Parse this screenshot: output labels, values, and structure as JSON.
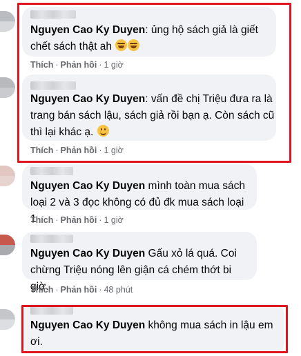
{
  "colors": {
    "bubble": "#f0f2f5",
    "text": "#050505",
    "meta": "#65676b",
    "highlight": "#e0141e"
  },
  "comments": [
    {
      "author": "Nguyen Cao Ky Duyen",
      "text": ": ủng hộ sách giả là giết chết sách thật ah",
      "emoji": [
        "laugh-icon",
        "laugh-icon"
      ],
      "like": "Thích",
      "reply": "Phản hồi",
      "time": "1 giờ",
      "highlighted": true
    },
    {
      "author": "Nguyen Cao Ky Duyen",
      "text": ": vấn đề chị Triệu đưa ra là trang bán sách lậu, sách giả rồi bạn ạ. Còn sách cũ thì lại khác ạ.",
      "emoji": [
        "smile-icon"
      ],
      "like": "Thích",
      "reply": "Phản hồi",
      "time": "1 giờ",
      "highlighted": true
    },
    {
      "author": "Nguyen Cao Ky Duyen",
      "text": " mình toàn mua sách loại 2 và 3 đọc không có đủ đk mua sách loại 1",
      "like": "Thích",
      "reply": "Phản hồi",
      "time": "1 giờ",
      "highlighted": false
    },
    {
      "author": "Nguyen Cao Ky Duyen",
      "text": " Gấu xỏ lá quá. Coi chừng Triệu nóng lên giận cá chém thớt bi giờ.",
      "like": "Thích",
      "reply": "Phản hồi",
      "time": "48 phút",
      "highlighted": false
    },
    {
      "author": "Nguyen Cao Ky Duyen",
      "text": " không mua sách in lậu em ơi.",
      "highlighted": true
    }
  ]
}
